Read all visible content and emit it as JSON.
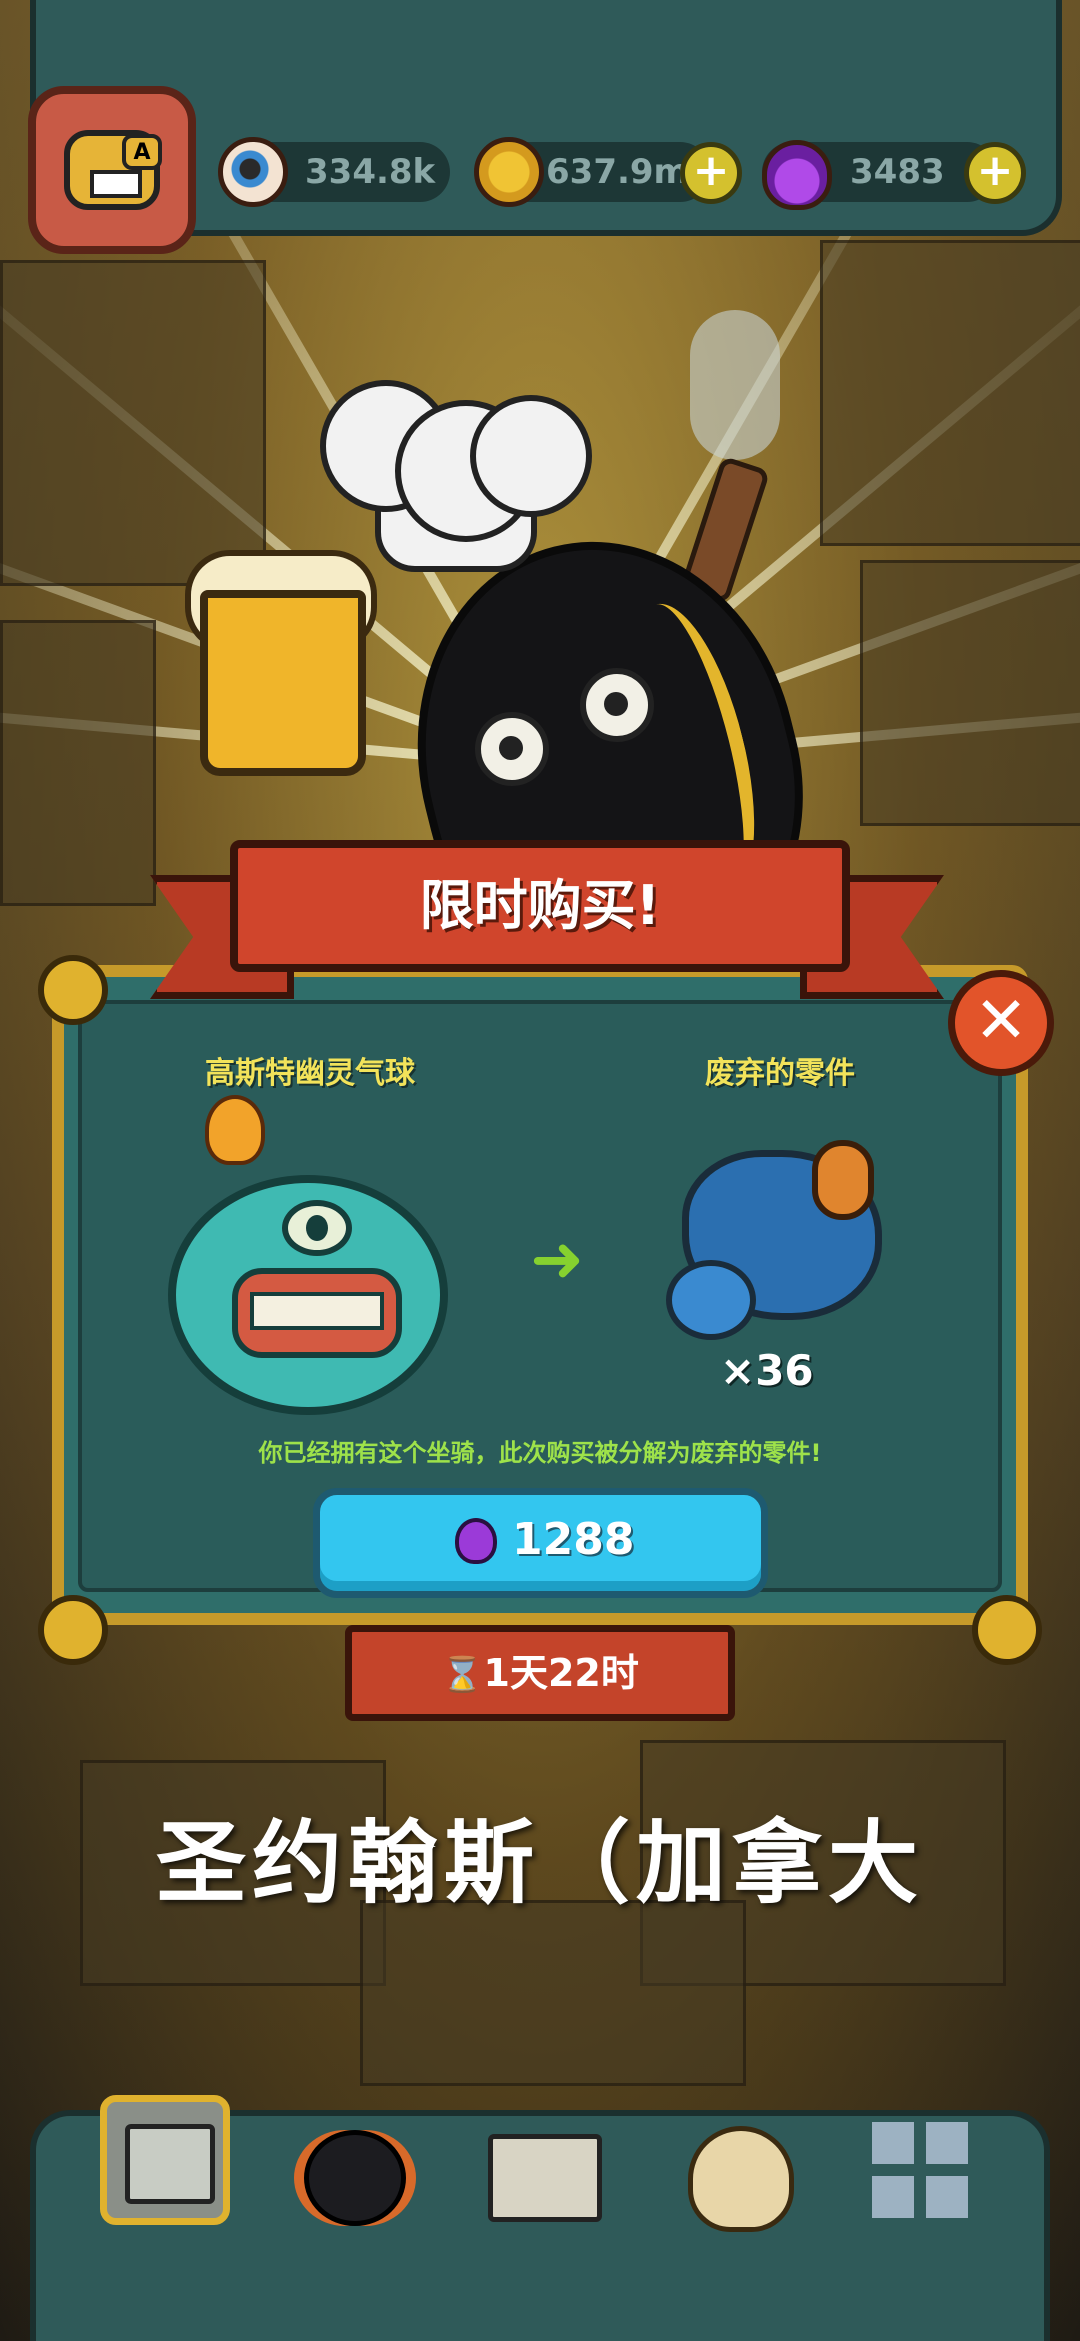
{
  "top_bar": {
    "avatar_badge": "A",
    "resources": [
      {
        "icon": "eyeball-icon",
        "value": "334.8k",
        "has_plus": false
      },
      {
        "icon": "gold-coin-icon",
        "value": "637.9m",
        "has_plus": true
      },
      {
        "icon": "potion-icon",
        "value": "3483",
        "has_plus": true
      }
    ]
  },
  "offer": {
    "banner_title": "限时购买!",
    "left_item_title": "高斯特幽灵气球",
    "right_item_title": "废弃的零件",
    "quantity": "×36",
    "notice": "你已经拥有这个坐骑，此次购买被分解为废弃的零件!",
    "price": "1288",
    "timer": "1天22时",
    "close_symbol": "✕",
    "arrow_symbol": "➜"
  },
  "caption": "圣约翰斯（加拿大",
  "bottom_nav": {
    "items": [
      "shop-icon",
      "monster-icon",
      "book-icon",
      "money-bag-icon",
      "grid-menu-icon"
    ]
  },
  "colors": {
    "panel": "#2f6e6a",
    "gold_frame": "#c69a2a",
    "banner_red": "#d0452c",
    "buy_button": "#33c6ef",
    "notice_green": "#9ee24a",
    "title_yellow": "#f2e35a"
  }
}
